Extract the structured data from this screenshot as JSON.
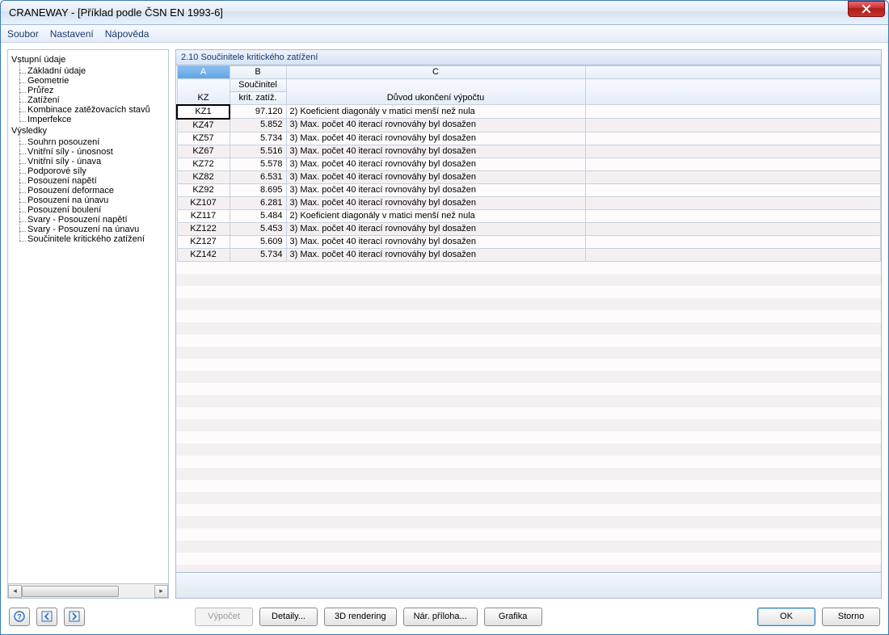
{
  "title": "CRANEWAY - [Příklad podle ČSN EN 1993-6]",
  "menu": {
    "file": "Soubor",
    "settings": "Nastavení",
    "help": "Nápověda"
  },
  "tree": {
    "root1": "Vstupní údaje",
    "r1": [
      "Základní údaje",
      "Geometrie",
      "Průřez",
      "Zatížení",
      "Kombinace zatěžovacích stavů",
      "Imperfekce"
    ],
    "root2": "Výsledky",
    "r2": [
      "Souhrn posouzení",
      "Vnitřní síly - únosnost",
      "Vnitřní síly - únava",
      "Podporové síly",
      "Posouzení napětí",
      "Posouzení deformace",
      "Posouzení na únavu",
      "Posouzení boulení",
      "Svary - Posouzení napětí",
      "Svary - Posouzení na únavu",
      "Součinitele kritického zatížení"
    ]
  },
  "panel_title": "2.10 Součinitele kritického zatížení",
  "cols": {
    "A": "A",
    "B": "B",
    "C": "C",
    "a_sub": "KZ",
    "b_sub1": "Součinitel",
    "b_sub2": "krit. zatíž.",
    "c_sub": "Důvod ukončení výpočtu"
  },
  "rows": [
    {
      "a": "KZ1",
      "b": "97.120",
      "c": "2) Koeficient diagonály v matici menší než nula"
    },
    {
      "a": "KZ47",
      "b": "5.852",
      "c": "3) Max. počet 40 iterací rovnováhy byl dosažen"
    },
    {
      "a": "KZ57",
      "b": "5.734",
      "c": "3) Max. počet 40 iterací rovnováhy byl dosažen"
    },
    {
      "a": "KZ67",
      "b": "5.516",
      "c": "3) Max. počet 40 iterací rovnováhy byl dosažen"
    },
    {
      "a": "KZ72",
      "b": "5.578",
      "c": "3) Max. počet 40 iterací rovnováhy byl dosažen"
    },
    {
      "a": "KZ82",
      "b": "6.531",
      "c": "3) Max. počet 40 iterací rovnováhy byl dosažen"
    },
    {
      "a": "KZ92",
      "b": "8.695",
      "c": "3) Max. počet 40 iterací rovnováhy byl dosažen"
    },
    {
      "a": "KZ107",
      "b": "6.281",
      "c": "3) Max. počet 40 iterací rovnováhy byl dosažen"
    },
    {
      "a": "KZ117",
      "b": "5.484",
      "c": "2) Koeficient diagonály v matici menší než nula"
    },
    {
      "a": "KZ122",
      "b": "5.453",
      "c": "3) Max. počet 40 iterací rovnováhy byl dosažen"
    },
    {
      "a": "KZ127",
      "b": "5.609",
      "c": "3) Max. počet 40 iterací rovnováhy byl dosažen"
    },
    {
      "a": "KZ142",
      "b": "5.734",
      "c": "3) Max. počet 40 iterací rovnováhy byl dosažen"
    }
  ],
  "buttons": {
    "calc": "Výpočet",
    "details": "Detaily...",
    "render": "3D rendering",
    "attach": "Nár. příloha...",
    "graphics": "Grafika",
    "ok": "OK",
    "cancel": "Storno"
  }
}
